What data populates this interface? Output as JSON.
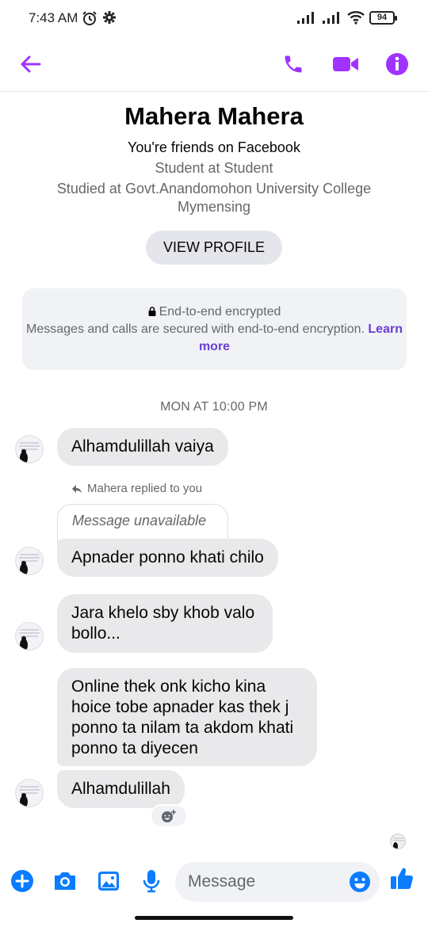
{
  "status_bar": {
    "time": "7:43 AM",
    "battery": "94"
  },
  "header": {
    "back_icon": "arrow-left-icon",
    "call_icon": "phone-icon",
    "video_icon": "video-camera-icon",
    "info_icon": "info-icon",
    "accent_color": "#a033ff"
  },
  "profile": {
    "name": "Mahera Mahera",
    "friends": "You're friends on Facebook",
    "work": "Student at Student",
    "education": "Studied at Govt.Anandomohon University College Mymensing",
    "view_profile": "VIEW PROFILE"
  },
  "encryption": {
    "title": "End-to-end encrypted",
    "body": "Messages and calls are secured with end-to-end encryption.",
    "link": "Learn more"
  },
  "thread": {
    "timestamp": "MON AT 10:00 PM",
    "reply_note": "Mahera replied to you",
    "reply_quote": "Message unavailable",
    "messages": [
      "Alhamdulillah vaiya",
      "Apnader ponno khati chilo",
      "Jara khelo sby khob valo bollo...",
      "Online thek onk kicho kina hoice tobe apnader kas thek j ponno ta nilam ta akdom khati ponno ta diyecen",
      "Alhamdulillah"
    ]
  },
  "composer": {
    "placeholder": "Message",
    "accent_color": "#0a7cff"
  }
}
